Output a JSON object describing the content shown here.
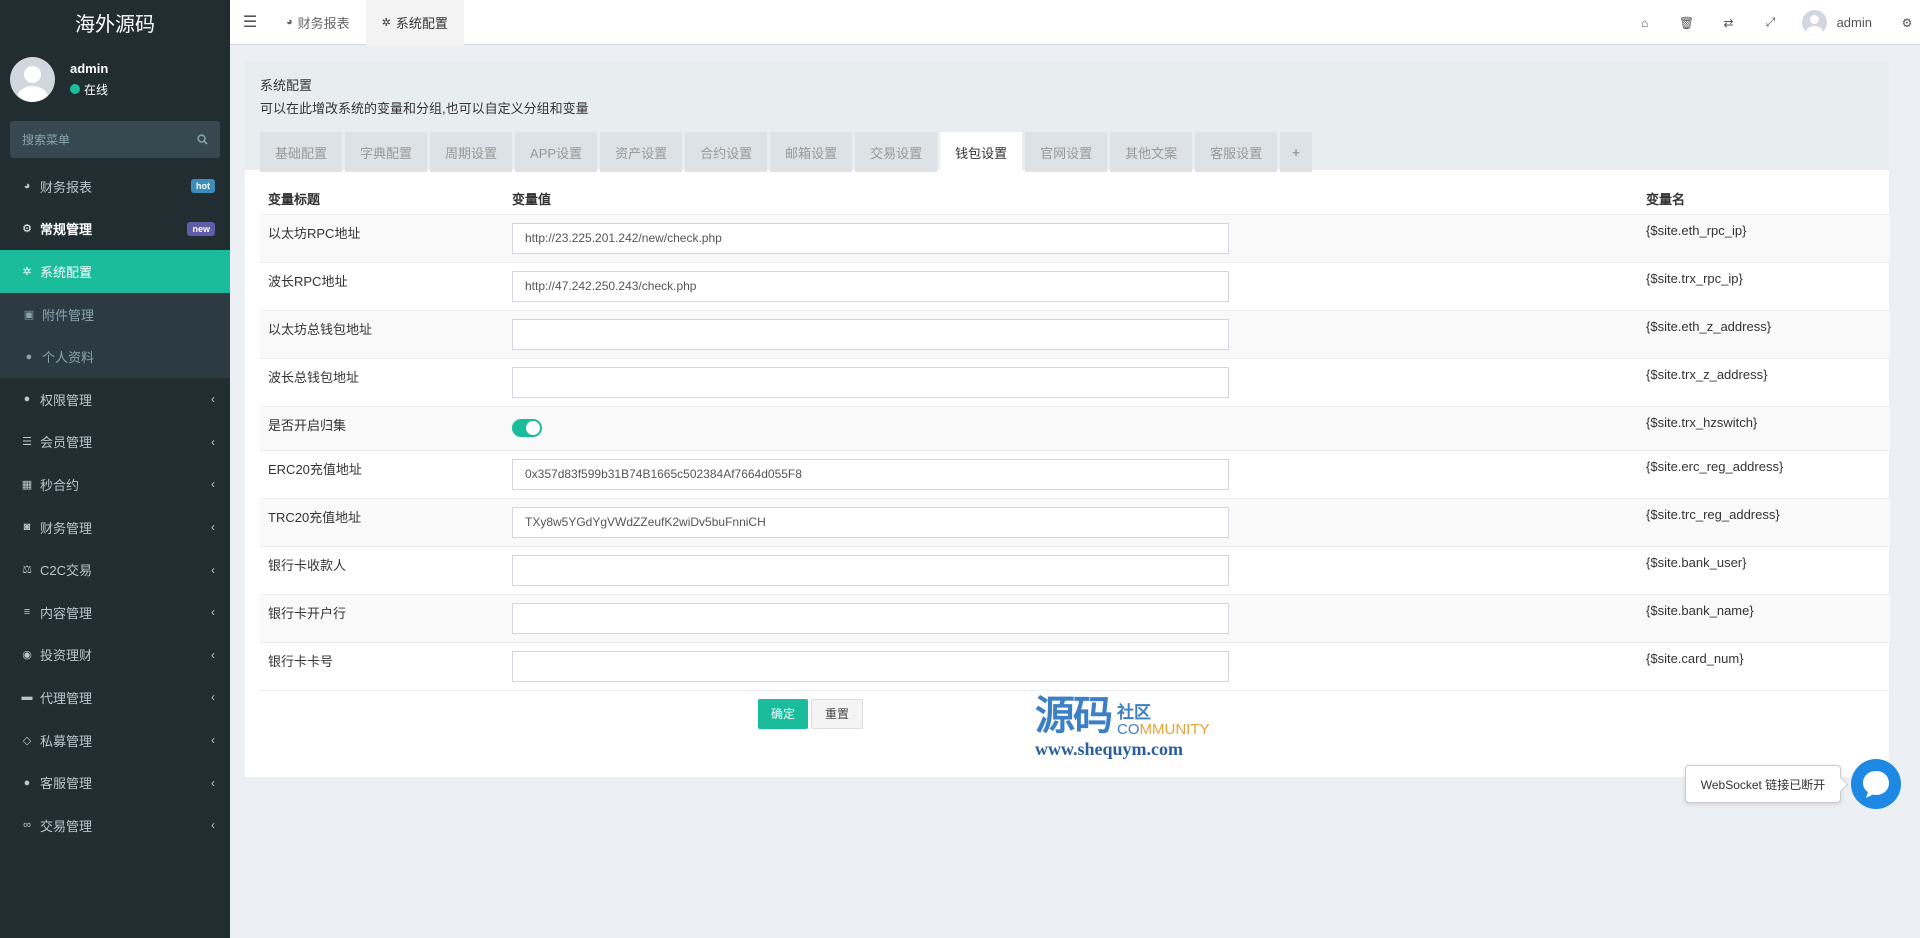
{
  "sidebar": {
    "brand": "海外源码",
    "user": {
      "name": "admin",
      "status": "在线"
    },
    "search_placeholder": "搜索菜单",
    "items": [
      {
        "label": "财务报表",
        "icon": "dashboard-icon",
        "badge": "hot"
      },
      {
        "label": "常规管理",
        "icon": "cogs-icon",
        "badge": "new"
      },
      {
        "label": "系统配置",
        "icon": "gear-icon"
      },
      {
        "label": "附件管理",
        "icon": "file-image-icon"
      },
      {
        "label": "个人资料",
        "icon": "user-icon"
      },
      {
        "label": "权限管理",
        "icon": "group-icon"
      },
      {
        "label": "会员管理",
        "icon": "list-icon"
      },
      {
        "label": "秒合约",
        "icon": "calendar-icon"
      },
      {
        "label": "财务管理",
        "icon": "database-icon"
      },
      {
        "label": "C2C交易",
        "icon": "balance-scale-icon"
      },
      {
        "label": "内容管理",
        "icon": "align-left-icon"
      },
      {
        "label": "投资理财",
        "icon": "compass-icon"
      },
      {
        "label": "代理管理",
        "icon": "briefcase-icon"
      },
      {
        "label": "私募管理",
        "icon": "diamond-icon"
      },
      {
        "label": "客服管理",
        "icon": "comment-icon"
      },
      {
        "label": "交易管理",
        "icon": "handshake-icon"
      }
    ]
  },
  "header": {
    "tabs": [
      {
        "label": "财务报表",
        "icon": "dashboard-icon"
      },
      {
        "label": "系统配置",
        "icon": "gear-icon"
      }
    ],
    "user": "admin"
  },
  "main": {
    "title": "系统配置",
    "subtitle": "可以在此增改系统的变量和分组,也可以自定义分组和变量",
    "tabs": [
      "基础配置",
      "字典配置",
      "周期设置",
      "APP设置",
      "资产设置",
      "合约设置",
      "邮箱设置",
      "交易设置",
      "钱包设置",
      "官网设置",
      "其他文案",
      "客服设置",
      "+"
    ],
    "active_tab": "钱包设置",
    "columns": {
      "title": "变量标题",
      "value": "变量值",
      "name": "变量名"
    },
    "rows": [
      {
        "title": "以太坊RPC地址",
        "value": "http://23.225.201.242/new/check.php",
        "name": "{$site.eth_rpc_ip}"
      },
      {
        "title": "波长RPC地址",
        "value": "http://47.242.250.243/check.php",
        "name": "{$site.trx_rpc_ip}"
      },
      {
        "title": "以太坊总钱包地址",
        "value": "",
        "name": "{$site.eth_z_address}"
      },
      {
        "title": "波长总钱包地址",
        "value": "",
        "name": "{$site.trx_z_address}"
      },
      {
        "title": "是否开启归集",
        "value": "",
        "name": "{$site.trx_hzswitch}",
        "toggle": true
      },
      {
        "title": "ERC20充值地址",
        "value": "0x357d83f599b31B74B1665c502384Af7664d055F8",
        "name": "{$site.erc_reg_address}"
      },
      {
        "title": "TRC20充值地址",
        "value": "TXy8w5YGdYgVWdZZeufK2wiDv5buFnniCH",
        "name": "{$site.trc_reg_address}"
      },
      {
        "title": "银行卡收款人",
        "value": "",
        "name": "{$site.bank_user}"
      },
      {
        "title": "银行卡开户行",
        "value": "",
        "name": "{$site.bank_name}"
      },
      {
        "title": "银行卡卡号",
        "value": "",
        "name": "{$site.card_num}"
      }
    ],
    "buttons": {
      "submit": "确定",
      "reset": "重置"
    }
  },
  "watermark": {
    "big": "源码",
    "cn": "社区",
    "en_a": "CO",
    "en_b": "MMUNITY",
    "url": "www.shequym.com"
  },
  "websocket_tip": "WebSocket 链接已断开",
  "colors": {
    "accent": "#1abc9c",
    "sidebar": "#222d32",
    "bubble": "#1e88e5"
  }
}
